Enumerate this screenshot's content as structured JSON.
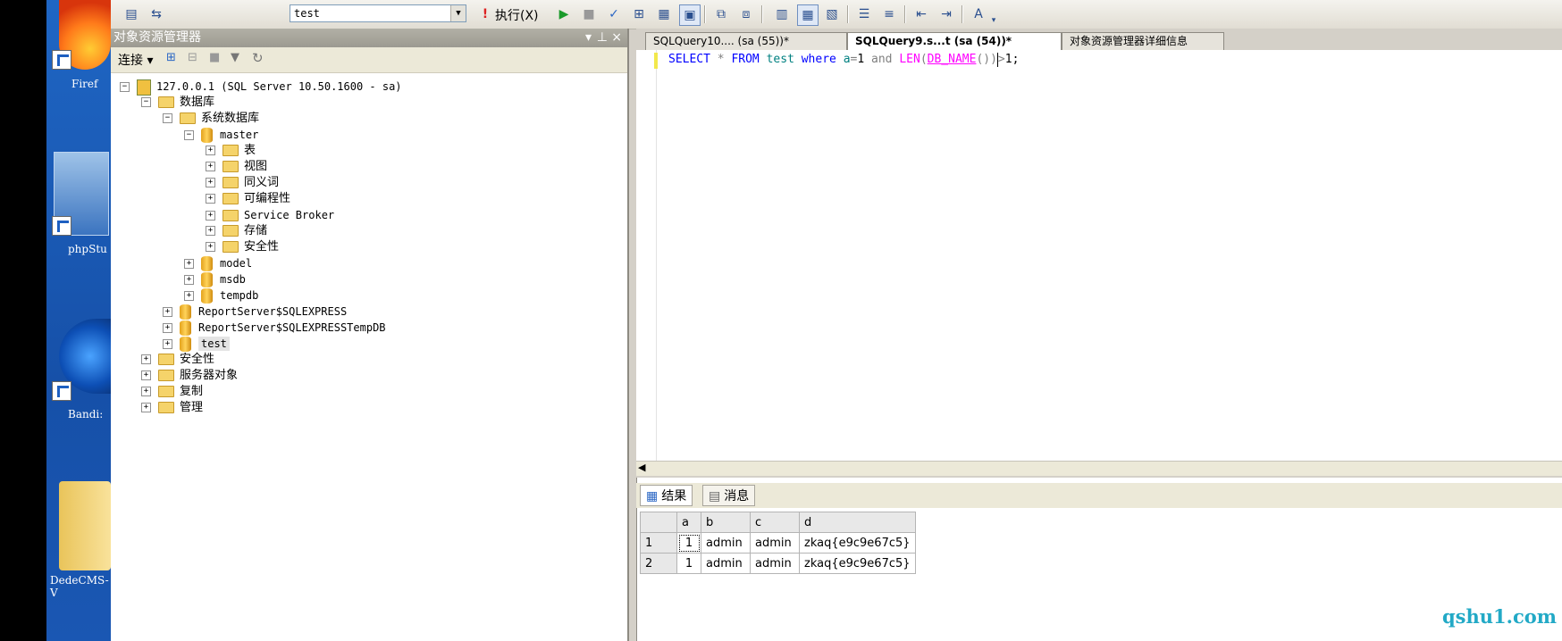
{
  "desktop": {
    "icons": [
      {
        "label": "Firef"
      },
      {
        "label": "phpStu"
      },
      {
        "label": "Bandi:"
      },
      {
        "label": "DedeCMS-V"
      }
    ]
  },
  "toolbar": {
    "database": "test",
    "execute_label": "执行(X)"
  },
  "object_explorer": {
    "title": "对象资源管理器",
    "title_controls": [
      "▾",
      "ₚ",
      "×"
    ],
    "connect_label": "连接 ▾",
    "tree": [
      {
        "label": "127.0.0.1 (SQL Server 10.50.1600 - sa)",
        "toggle": "−"
      },
      {
        "label": "数据库",
        "toggle": "−"
      },
      {
        "label": "系统数据库",
        "toggle": "−"
      },
      {
        "label": "master",
        "toggle": "−"
      },
      {
        "label": "表",
        "toggle": "+"
      },
      {
        "label": "视图",
        "toggle": "+"
      },
      {
        "label": "同义词",
        "toggle": "+"
      },
      {
        "label": "可编程性",
        "toggle": "+"
      },
      {
        "label": "Service Broker",
        "toggle": "+"
      },
      {
        "label": "存储",
        "toggle": "+"
      },
      {
        "label": "安全性",
        "toggle": "+"
      },
      {
        "label": "model",
        "toggle": "+"
      },
      {
        "label": "msdb",
        "toggle": "+"
      },
      {
        "label": "tempdb",
        "toggle": "+"
      },
      {
        "label": "ReportServer$SQLEXPRESS",
        "toggle": "+"
      },
      {
        "label": "ReportServer$SQLEXPRESSTempDB",
        "toggle": "+"
      },
      {
        "label": "test",
        "toggle": "+"
      },
      {
        "label": "安全性",
        "toggle": "+"
      },
      {
        "label": "服务器对象",
        "toggle": "+"
      },
      {
        "label": "复制",
        "toggle": "+"
      },
      {
        "label": "管理",
        "toggle": "+"
      }
    ]
  },
  "editor": {
    "tabs": [
      {
        "label": "SQLQuery10.... (sa (55))*"
      },
      {
        "label": "SQLQuery9.s...t (sa (54))*"
      },
      {
        "label": "对象资源管理器详细信息"
      }
    ],
    "sql": {
      "t1": "SELECT",
      "t2": " * ",
      "t3": "FROM",
      "t4": " test ",
      "t5": "where",
      "t6": " a",
      "t7": "=",
      "t8": "1 ",
      "t9": "and",
      "t10": " ",
      "t11": "LEN",
      "t12": "(",
      "t13": "DB_NAME",
      "t14": "())",
      "t15": ">",
      "t16": "1",
      "t17": ";"
    }
  },
  "results": {
    "tabs": [
      {
        "label": "结果"
      },
      {
        "label": "消息"
      }
    ],
    "columns": [
      "a",
      "b",
      "c",
      "d"
    ],
    "rows": [
      {
        "n": "1",
        "a": "1",
        "b": "admin",
        "c": "admin",
        "d": "zkaq{e9c9e67c5}"
      },
      {
        "n": "2",
        "a": "1",
        "b": "admin",
        "c": "admin",
        "d": "zkaq{e9c9e67c5}"
      }
    ]
  },
  "watermark": "qshu1.com"
}
